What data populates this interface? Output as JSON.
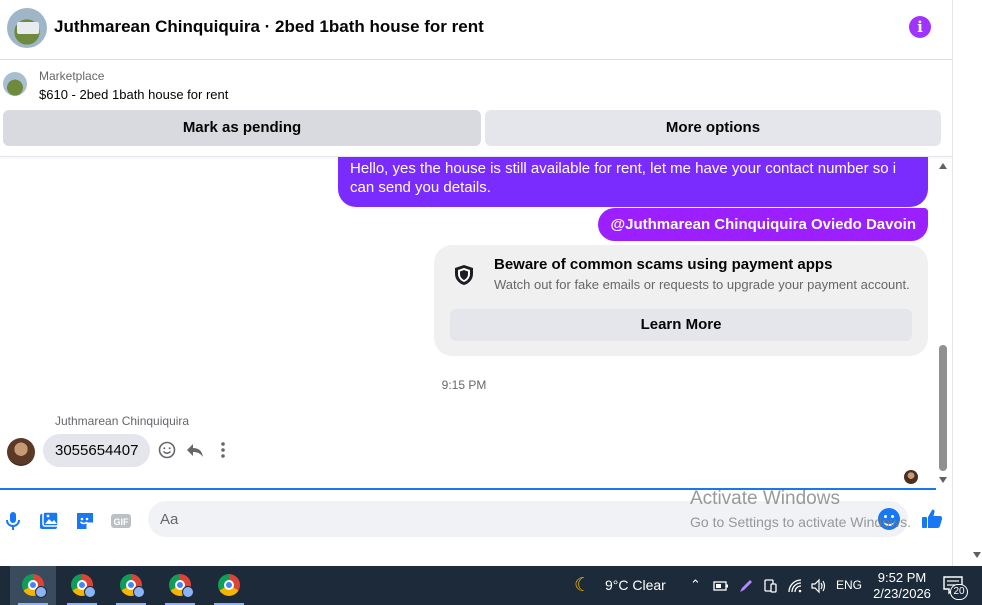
{
  "header": {
    "title": "Juthmarean Chinquiquira · 2bed 1bath house for rent",
    "info_icon": "info-icon"
  },
  "listing": {
    "source": "Marketplace",
    "price_title": "$610 - 2bed 1bath house for rent"
  },
  "actions": {
    "mark_pending": "Mark as pending",
    "more_options": "More options"
  },
  "messages": {
    "outgoing_text": "Hello, yes the house is still available for rent, let me have your contact number so i can send you details.",
    "mention": "@Juthmarean Chinquiquira Oviedo Davoin",
    "scam_title": "Beware of common scams using payment apps",
    "scam_subtitle": "Watch out for fake emails or requests to upgrade your payment account.",
    "learn_more": "Learn More",
    "timestamp": "9:15 PM",
    "sender_name": "Juthmarean Chinquiquira",
    "incoming_text": "3055654407"
  },
  "composer": {
    "placeholder": "Aa"
  },
  "watermark": {
    "line1": "Activate Windows",
    "line2": "Go to Settings to activate Windows."
  },
  "taskbar": {
    "weather": "9°C  Clear",
    "language": "ENG",
    "time": "9:52 PM",
    "date": "2/23/2026",
    "notification_count": "20"
  },
  "colors": {
    "accent_purple": "#7a2cff",
    "messenger_blue": "#1877f2",
    "taskbar": "#1c2a3a"
  }
}
